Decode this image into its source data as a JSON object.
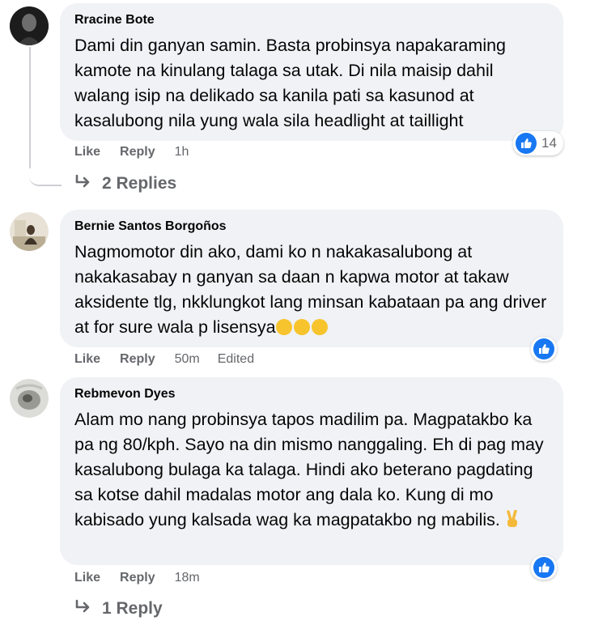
{
  "comments": [
    {
      "author": "Rracine Bote",
      "text": "Dami din ganyan samin. Basta probinsya napakaraming kamote na kinulang talaga sa utak. Di nila maisip dahil walang isip na delikado sa kanila pati sa kasunod at kasalubong nila yung wala sila headlight at taillight",
      "like_label": "Like",
      "reply_label": "Reply",
      "time": "1h",
      "reaction_count": "14",
      "replies_label": "2 Replies"
    },
    {
      "author": "Bernie Santos Borgoños",
      "text": "Nagmomotor din ako, dami ko n nakakasalubong at nakakasabay n ganyan sa daan n kapwa motor at takaw aksidente tlg, nkklungkot lang minsan kabataan pa ang driver at for sure wala p lisensya",
      "like_label": "Like",
      "reply_label": "Reply",
      "time": "50m",
      "edited_label": "Edited"
    },
    {
      "author": "Rebmevon Dyes",
      "text": "Alam mo nang probinsya tapos madilim pa. Magpatakbo ka pa ng 80/kph. Sayo na din mismo nanggaling. Eh di pag may kasalubong bulaga ka talaga. Hindi ako beterano pagdating sa kotse dahil madalas motor ang dala ko. Kung di mo kabisado yung kalsada wag ka magpatakbo ng mabilis.",
      "like_label": "Like",
      "reply_label": "Reply",
      "time": "18m",
      "replies_label": "1 Reply"
    }
  ],
  "colors": {
    "bubble": "#f0f2f5",
    "meta": "#65676b",
    "like_blue": "#1877f2",
    "thread_line": "#ced0d4"
  },
  "icons": [
    "like-icon",
    "reply-arrow-icon",
    "pensive-emoji",
    "sad-emoji",
    "victory-hand-emoji"
  ]
}
